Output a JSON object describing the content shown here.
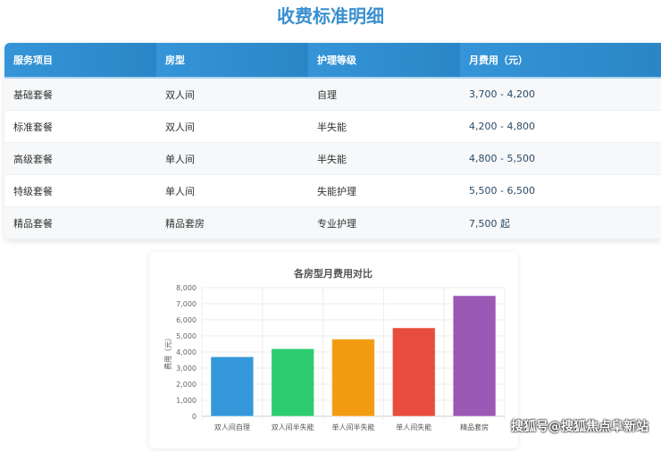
{
  "title": "收费标准明细",
  "table": {
    "headers": [
      "服务项目",
      "房型",
      "护理等级",
      "月费用（元）"
    ],
    "rows": [
      [
        "基础套餐",
        "双人间",
        "自理",
        "3,700 - 4,200"
      ],
      [
        "标准套餐",
        "双人间",
        "半失能",
        "4,200 - 4,800"
      ],
      [
        "高级套餐",
        "单人间",
        "半失能",
        "4,800 - 5,500"
      ],
      [
        "特级套餐",
        "单人间",
        "失能护理",
        "5,500 - 6,500"
      ],
      [
        "精品套餐",
        "精品套房",
        "专业护理",
        "7,500 起"
      ]
    ]
  },
  "chart_data": {
    "type": "bar",
    "title": "各房型月费用对比",
    "ylabel": "费用（元）",
    "xlabel": "",
    "categories": [
      "双人间自理",
      "双人间半失能",
      "单人间半失能",
      "单人间失能",
      "精品套房"
    ],
    "values": [
      3700,
      4200,
      4800,
      5500,
      7500
    ],
    "colors": [
      "#3498db",
      "#2ecc71",
      "#f39c12",
      "#e74c3c",
      "#9b59b6"
    ],
    "ylim": [
      0,
      8000
    ],
    "yticks": [
      "0",
      "1,000",
      "2,000",
      "3,000",
      "4,000",
      "5,000",
      "6,000",
      "7,000",
      "8,000"
    ],
    "grid": true
  },
  "watermark": "搜狐号@搜狐焦点阜新站"
}
